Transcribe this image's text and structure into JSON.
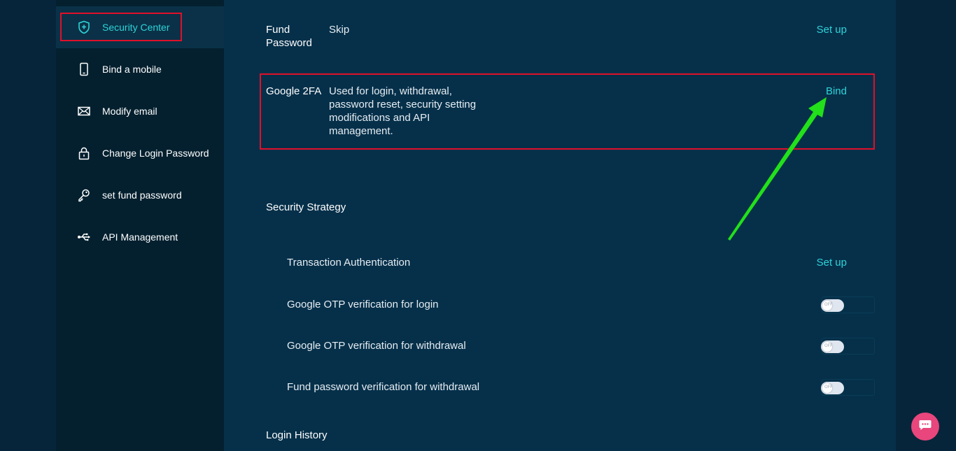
{
  "sidebar": {
    "items": [
      {
        "label": "Security Center",
        "icon": "shield-icon"
      },
      {
        "label": "Bind a mobile",
        "icon": "mobile-icon"
      },
      {
        "label": "Modify email",
        "icon": "email-icon"
      },
      {
        "label": "Change Login Password",
        "icon": "lock-icon"
      },
      {
        "label": "set fund password",
        "icon": "key-icon"
      },
      {
        "label": "API Management",
        "icon": "usb-icon"
      }
    ]
  },
  "fund_password": {
    "label": "Fund Password",
    "description": "Skip",
    "action": "Set up"
  },
  "google_2fa": {
    "label": "Google 2FA",
    "description": "Used for login, withdrawal, password reset, security setting modifications and API management.",
    "action": "Bind"
  },
  "security_strategy": {
    "title": "Security Strategy",
    "transaction_auth": {
      "label": "Transaction Authentication",
      "action": "Set up"
    },
    "toggles": [
      {
        "label": "Google OTP verification for login",
        "state": "OFF"
      },
      {
        "label": "Google OTP verification for withdrawal",
        "state": "OFF"
      },
      {
        "label": "Fund password verification for withdrawal",
        "state": "OFF"
      }
    ]
  },
  "login_history": {
    "title": "Login History"
  },
  "colors": {
    "accent": "#2ed3d8",
    "highlight": "#e0102a",
    "arrow": "#22e01a",
    "chat": "#e8467c"
  }
}
